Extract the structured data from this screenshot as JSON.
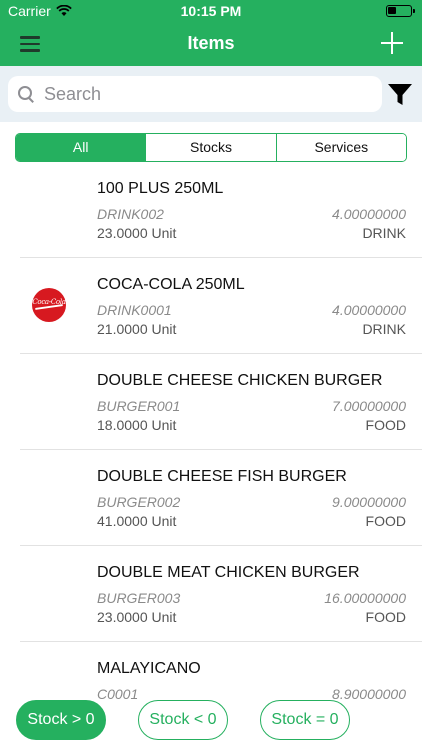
{
  "status_bar": {
    "carrier": "Carrier",
    "time": "10:15 PM"
  },
  "header": {
    "title": "Items",
    "menu_icon": "hamburger-menu-icon",
    "add_icon": "plus-icon"
  },
  "search": {
    "placeholder": "Search",
    "value": ""
  },
  "segments": [
    {
      "label": "All",
      "active": true
    },
    {
      "label": "Stocks",
      "active": false
    },
    {
      "label": "Services",
      "active": false
    }
  ],
  "items": [
    {
      "name": "100 PLUS 250ML",
      "code": "DRINK002",
      "price": "4.00000000",
      "qty": "23.0000 Unit",
      "category": "DRINK",
      "thumb": ""
    },
    {
      "name": "COCA-COLA 250ML",
      "code": "DRINK0001",
      "price": "4.00000000",
      "qty": "21.0000 Unit",
      "category": "DRINK",
      "thumb": "coca-cola-logo"
    },
    {
      "name": "DOUBLE CHEESE CHICKEN BURGER",
      "code": "BURGER001",
      "price": "7.00000000",
      "qty": "18.0000 Unit",
      "category": "FOOD",
      "thumb": ""
    },
    {
      "name": "DOUBLE CHEESE FISH BURGER",
      "code": "BURGER002",
      "price": "9.00000000",
      "qty": "41.0000 Unit",
      "category": "FOOD",
      "thumb": ""
    },
    {
      "name": "DOUBLE MEAT CHICKEN BURGER",
      "code": "BURGER003",
      "price": "16.00000000",
      "qty": "23.0000 Unit",
      "category": "FOOD",
      "thumb": ""
    },
    {
      "name": "MALAYICANO",
      "code": "C0001",
      "price": "8.90000000",
      "qty": "",
      "category": "",
      "thumb": ""
    }
  ],
  "stock_filters": [
    {
      "label": "Stock > 0",
      "active": true
    },
    {
      "label": "Stock < 0",
      "active": false
    },
    {
      "label": "Stock = 0",
      "active": false
    }
  ],
  "colors": {
    "primary": "#25b05f",
    "search_bg": "#e9f0f5"
  }
}
